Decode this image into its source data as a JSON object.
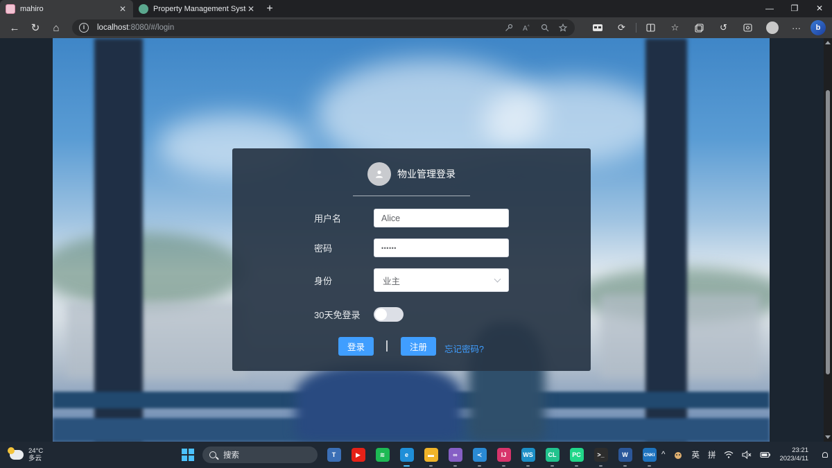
{
  "browser": {
    "tabs": [
      {
        "label": "mahiro",
        "active": true
      },
      {
        "label": "Property Management System",
        "active": false
      }
    ],
    "new_tab": "+",
    "window_controls": {
      "minimize": "—",
      "restore": "❐",
      "close": "✕"
    },
    "nav": {
      "back": "←",
      "reload": "↻",
      "home": "⌂"
    },
    "address": {
      "host": "localhost",
      "rest": ":8080/#/login"
    },
    "address_icons": [
      "key-icon",
      "read-aloud-icon",
      "zoom-icon",
      "favorite-add-icon"
    ],
    "toolbar_icons": [
      "extension-icon",
      "refresh-icon",
      "split-screen-icon",
      "favorites-icon",
      "collections-icon",
      "history-icon",
      "screenshot-icon",
      "profile-icon",
      "more-icon",
      "bing-icon"
    ],
    "more_label": "···",
    "bing_label": "b"
  },
  "login": {
    "title": "物业管理登录",
    "username": {
      "label": "用户名",
      "value": "Alice"
    },
    "password": {
      "label": "密码",
      "value": "••••••"
    },
    "role": {
      "label": "身份",
      "selected": "业主"
    },
    "remember": {
      "label": "30天免登录",
      "on": false
    },
    "login_button": "登录",
    "register_button": "注册",
    "forgot_link": "忘记密码?"
  },
  "taskbar": {
    "weather": {
      "temp": "24°C",
      "condition": "多云"
    },
    "search_placeholder": "搜索",
    "apps": [
      {
        "name": "app-typora",
        "glyph": "T",
        "color": "#3b6fb6"
      },
      {
        "name": "app-youtube",
        "glyph": "▶",
        "color": "#e62117"
      },
      {
        "name": "app-spotify",
        "glyph": "≋",
        "color": "#1db954"
      },
      {
        "name": "app-edge",
        "glyph": "e",
        "color": "#1f8fd8"
      },
      {
        "name": "app-file-explorer",
        "glyph": "▬",
        "color": "#f0b429"
      },
      {
        "name": "app-visual-studio",
        "glyph": "∞",
        "color": "#865fc5"
      },
      {
        "name": "app-vscode",
        "glyph": "≺",
        "color": "#2a8ad4"
      },
      {
        "name": "app-intellij",
        "glyph": "IJ",
        "color": "#d8346b"
      },
      {
        "name": "app-webstorm",
        "glyph": "WS",
        "color": "#1c8fc7"
      },
      {
        "name": "app-clion",
        "glyph": "CL",
        "color": "#22c38e"
      },
      {
        "name": "app-pycharm",
        "glyph": "PC",
        "color": "#21d789"
      },
      {
        "name": "app-terminal",
        "glyph": ">_",
        "color": "#2d2d2d"
      },
      {
        "name": "app-word",
        "glyph": "W",
        "color": "#2b579a"
      },
      {
        "name": "app-cnki",
        "glyph": "CNKI",
        "color": "#1e73be"
      }
    ],
    "tray": {
      "chevron": "^",
      "ime_lang": "英",
      "ime_mode": "拼",
      "time": "23:21",
      "date": "2023/4/11"
    }
  }
}
